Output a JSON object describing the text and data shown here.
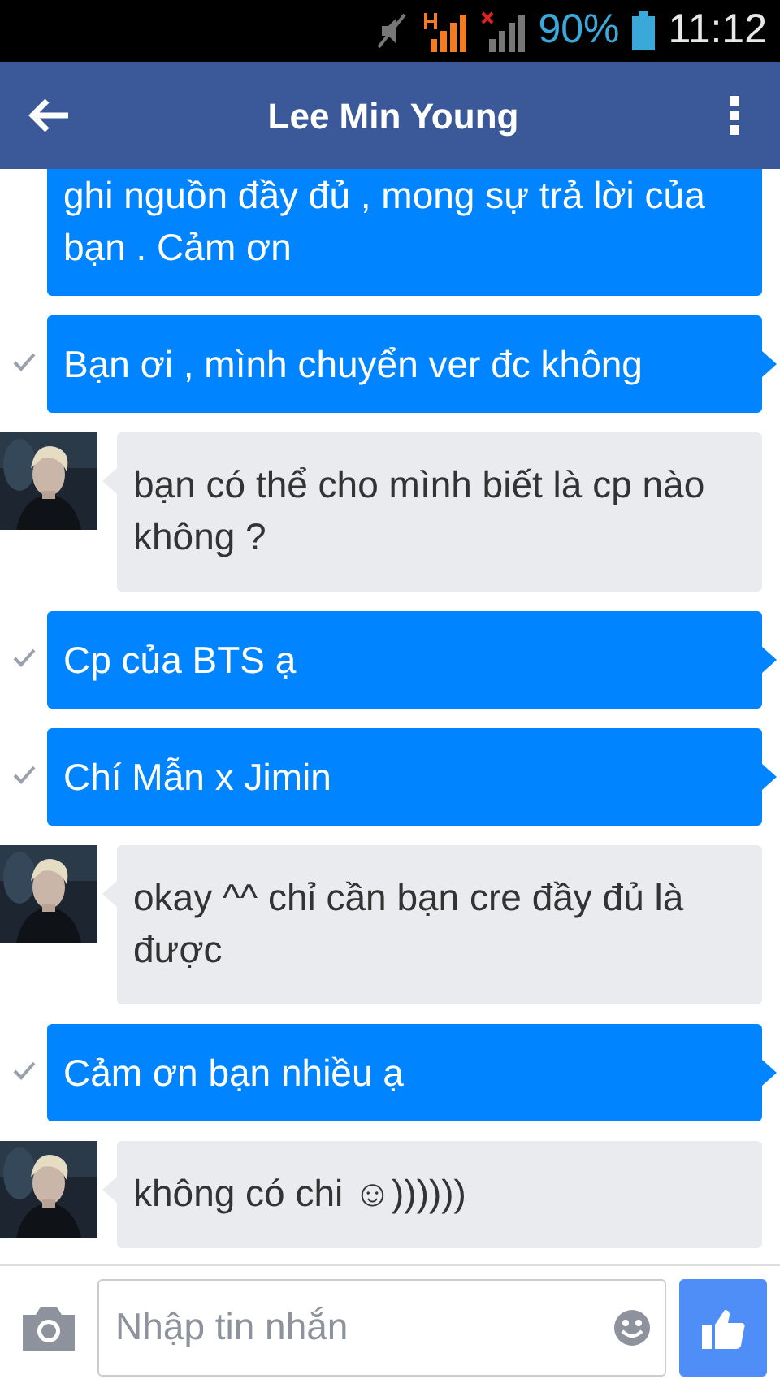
{
  "status_bar": {
    "battery": "90%",
    "time": "11:12"
  },
  "header": {
    "title": "Lee Min Young"
  },
  "messages": [
    {
      "kind": "sent",
      "text": "ghi nguồn đầy đủ , mong sự trả lời của bạn . Cảm ơn",
      "delivered": false
    },
    {
      "kind": "sent",
      "text": "Bạn ơi , mình chuyển ver đc không",
      "delivered": true
    },
    {
      "kind": "received",
      "text": "bạn có thể cho mình biết là cp nào không ?"
    },
    {
      "kind": "sent",
      "text": "Cp của BTS ạ",
      "delivered": true
    },
    {
      "kind": "sent",
      "text": "Chí Mẫn x Jimin",
      "delivered": true
    },
    {
      "kind": "received",
      "text": "okay ^^ chỉ cần bạn cre đầy đủ là được"
    },
    {
      "kind": "sent",
      "text": "Cảm ơn bạn nhiều ạ",
      "delivered": true
    },
    {
      "kind": "received",
      "text": "không có chi ☺))))))"
    }
  ],
  "composer": {
    "placeholder": "Nhập tin nhắn"
  }
}
